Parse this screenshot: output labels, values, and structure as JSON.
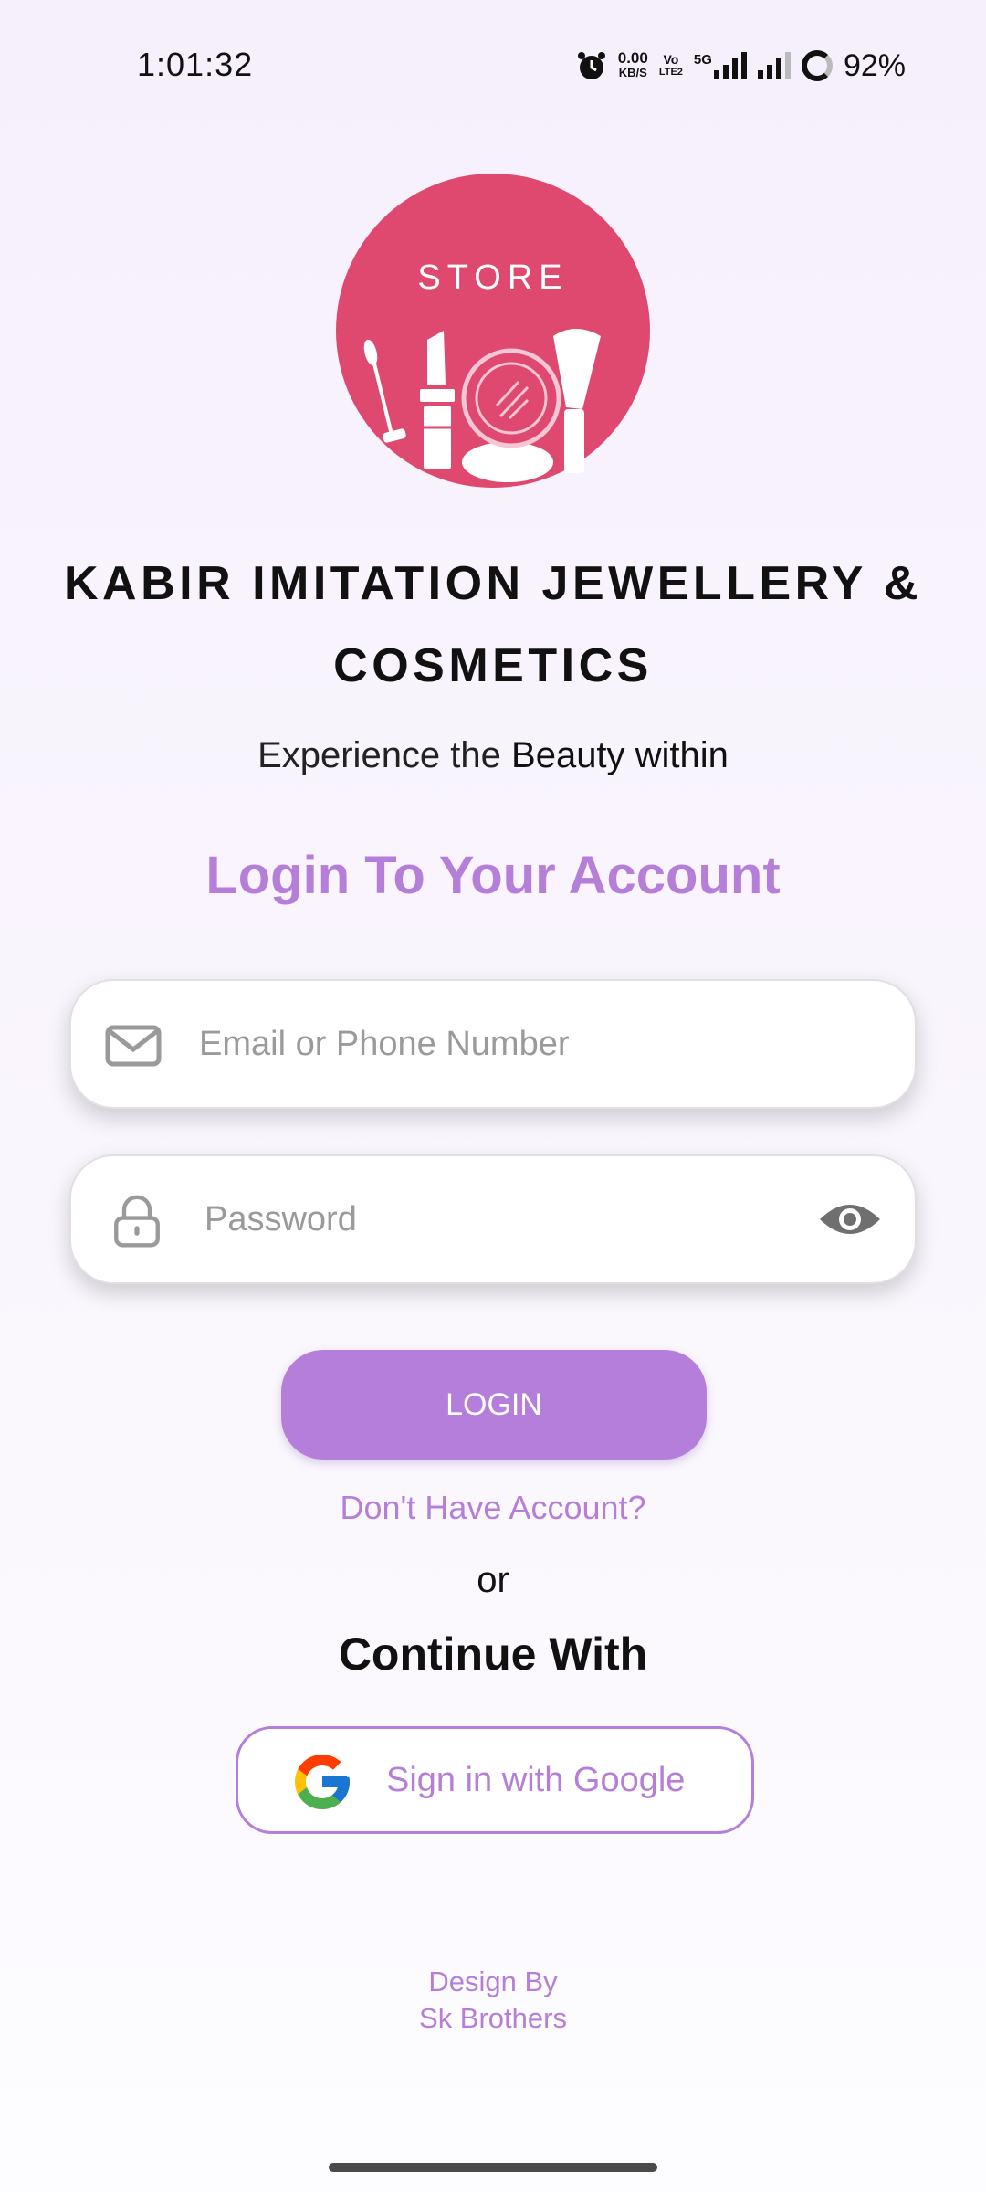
{
  "status_bar": {
    "time": "1:01:32",
    "net_speed_value": "0.00",
    "net_speed_unit": "KB/S",
    "volte_top": "Vo",
    "volte_bottom": "LTE2",
    "network_type": "5G",
    "battery": "92%"
  },
  "logo": {
    "text": "STORE",
    "color": "#e0496f"
  },
  "brand": {
    "line1": "KABIR IMITATION JEWELLERY &",
    "line2": "COSMETICS"
  },
  "tagline": {
    "part1": "Experience the ",
    "part2": "Beauty within"
  },
  "login_heading": "Login To Your Account",
  "email_field": {
    "placeholder": "Email or Phone Number",
    "icon": "mail-icon"
  },
  "password_field": {
    "placeholder": "Password",
    "icon": "lock-icon",
    "toggle_icon": "eye-icon"
  },
  "login_button": "LOGIN",
  "no_account_link": "Don't Have Account?",
  "or_text": "or",
  "continue_with": "Continue With",
  "google_button": "Sign in with Google",
  "footer": {
    "line1": "Design By",
    "line2": "Sk Brothers"
  },
  "colors": {
    "accent": "#b57ed9",
    "logo": "#e0496f",
    "button": "#b67edb"
  }
}
